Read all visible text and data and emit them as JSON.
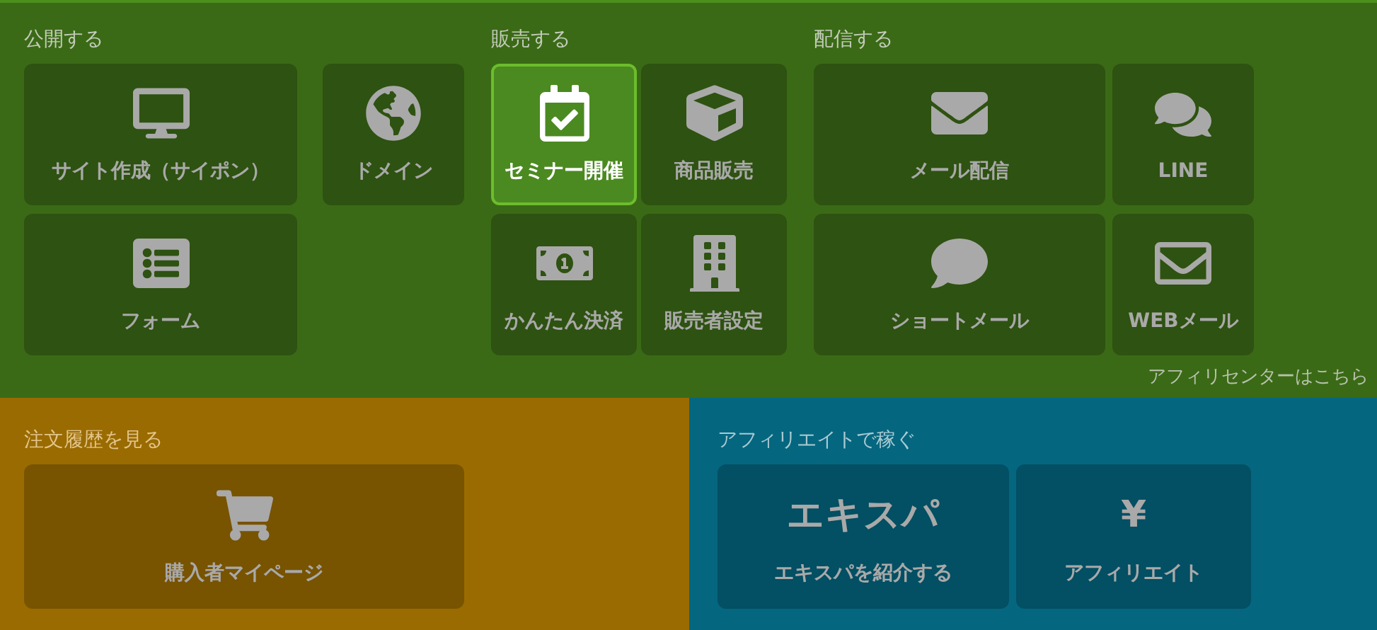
{
  "top_panel": {
    "sections": [
      {
        "title": "公開する",
        "tiles": [
          {
            "label": "サイト作成（サイポン）",
            "selected": false
          },
          {
            "label": "ドメイン",
            "selected": false
          },
          {
            "label": "フォーム",
            "selected": false
          }
        ]
      },
      {
        "title": "販売する",
        "tiles": [
          {
            "label": "セミナー開催",
            "selected": true
          },
          {
            "label": "商品販売",
            "selected": false
          },
          {
            "label": "かんたん決済",
            "selected": false
          },
          {
            "label": "販売者設定",
            "selected": false
          }
        ]
      },
      {
        "title": "配信する",
        "tiles": [
          {
            "label": "メール配信",
            "selected": false
          },
          {
            "label": "LINE",
            "selected": false
          },
          {
            "label": "ショートメール",
            "selected": false
          },
          {
            "label": "WEBメール",
            "selected": false
          }
        ]
      }
    ],
    "link": "アフィリセンターはこちら"
  },
  "bottom_panels": [
    {
      "title": "注文履歴を見る",
      "tiles": [
        {
          "label": "購入者マイページ",
          "selected": false
        }
      ]
    },
    {
      "title": "アフィリエイトで稼ぐ",
      "tiles": [
        {
          "label": "エキスパを紹介する",
          "icon_text": "エキスパ",
          "selected": false
        },
        {
          "label": "アフィリエイト",
          "icon_text": "¥",
          "selected": false
        }
      ]
    }
  ]
}
